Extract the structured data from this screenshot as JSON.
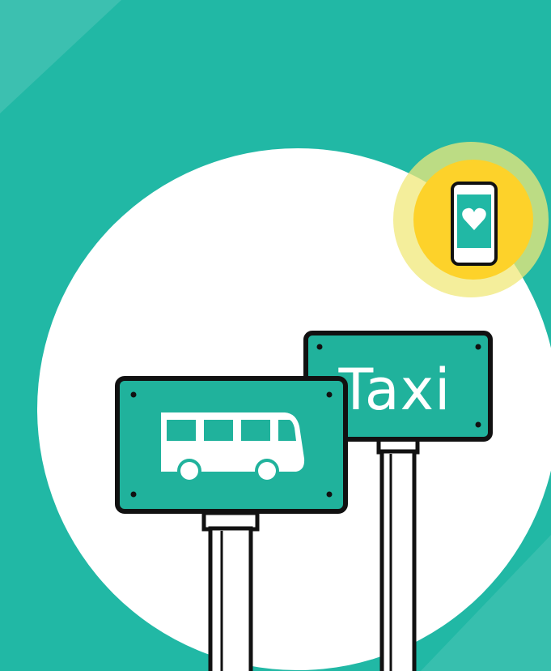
{
  "illustration": {
    "taxi_sign": {
      "label": "Taxi"
    },
    "bus_sign": {
      "icon": "bus-icon"
    },
    "phone_badge": {
      "icon": "phone-heart-icon"
    }
  },
  "colors": {
    "background_teal": "#21b8a5",
    "sign_teal": "#20b29c",
    "circle_white": "#ffffff",
    "outline": "#111111",
    "badge_yellow": "#fdd22a",
    "badge_halo": "#f2ea7a"
  }
}
